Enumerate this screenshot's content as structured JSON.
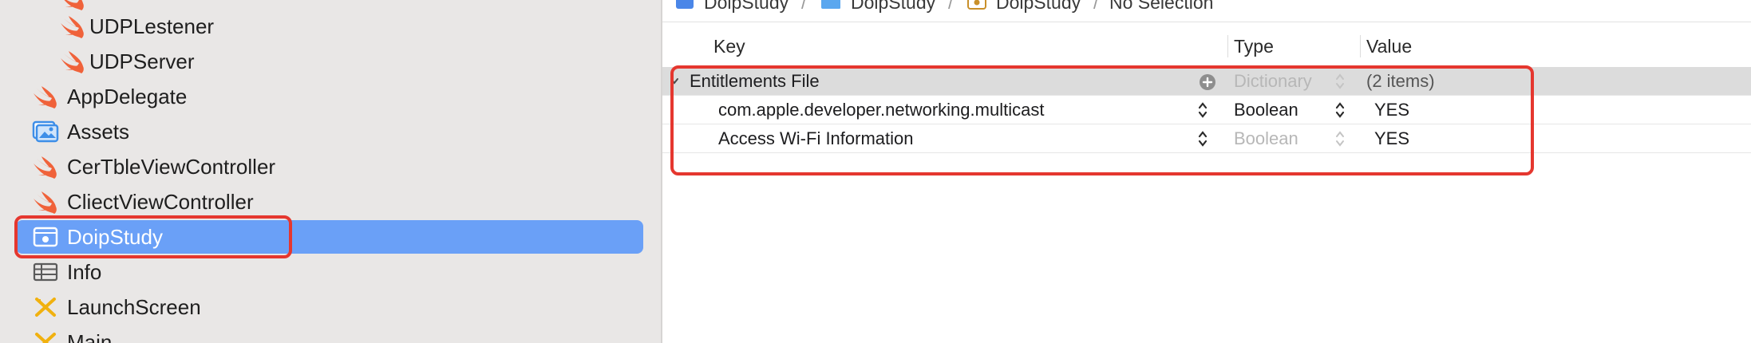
{
  "sidebar": {
    "items": [
      {
        "label": "UDPLestener",
        "icon": "swift-icon"
      },
      {
        "label": "UDPServer",
        "icon": "swift-icon"
      },
      {
        "label": "AppDelegate",
        "icon": "swift-icon"
      },
      {
        "label": "Assets",
        "icon": "asset-catalog-icon"
      },
      {
        "label": "CerTbleViewController",
        "icon": "swift-icon"
      },
      {
        "label": "CliectViewController",
        "icon": "swift-icon"
      },
      {
        "label": "DoipStudy",
        "icon": "entitlements-icon",
        "selected": true
      },
      {
        "label": "Info",
        "icon": "plist-table-icon"
      },
      {
        "label": "LaunchScreen",
        "icon": "storyboard-icon"
      },
      {
        "label": "Main",
        "icon": "storyboard-icon"
      }
    ]
  },
  "jumpbar": {
    "crumbs": [
      "DoipStudy",
      "DoipStudy",
      "DoipStudy",
      "No Selection"
    ],
    "separator": "/"
  },
  "table": {
    "headers": {
      "key": "Key",
      "type": "Type",
      "value": "Value"
    },
    "root": {
      "key": "Entitlements File",
      "type": "Dictionary",
      "value": "(2 items)"
    },
    "rows": [
      {
        "key": "com.apple.developer.networking.multicast",
        "type": "Boolean",
        "value": "YES"
      },
      {
        "key": "Access Wi-Fi Information",
        "type": "Boolean",
        "value": "YES"
      }
    ]
  },
  "colors": {
    "selection": "#6aa0f7",
    "highlight": "#e5372f",
    "swift": "#f0623a",
    "folder": "#5aa7ef"
  }
}
